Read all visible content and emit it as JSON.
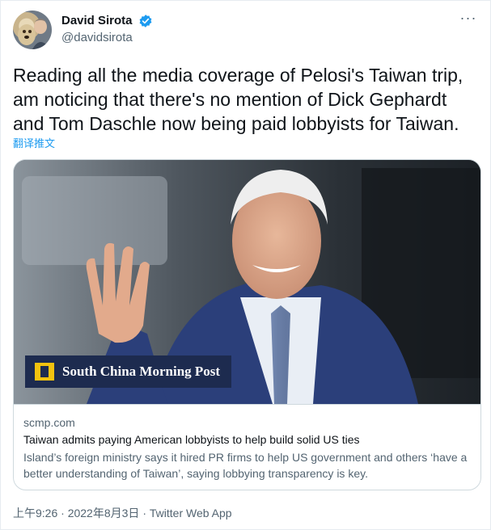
{
  "author": {
    "display_name": "David Sirota",
    "handle": "@davidsirota",
    "verified": true
  },
  "more_icon": "more-horizontal-icon",
  "tweet": {
    "text": "Reading all the media coverage of Pelosi's Taiwan trip, am noticing that there's no mention of Dick Gephardt and Tom Daschle now being paid lobbyists for Taiwan.",
    "translate_label": "翻译推文"
  },
  "card": {
    "brand_label": "South China Morning Post",
    "domain": "scmp.com",
    "title": "Taiwan admits paying American lobbyists to help build solid US ties",
    "description": "Island’s foreign ministry says it hired PR firms to help US government and others ‘have a better understanding of Taiwan’, saying lobbying transparency is key."
  },
  "meta": {
    "time": "上午9:26",
    "date": "2022年8月3日",
    "source": "Twitter Web App",
    "separator": "·"
  },
  "colors": {
    "accent": "#1d9bf0",
    "secondary_text": "#536471",
    "brand_bg": "#1d2b4f",
    "brand_logo": "#f2c20f"
  }
}
